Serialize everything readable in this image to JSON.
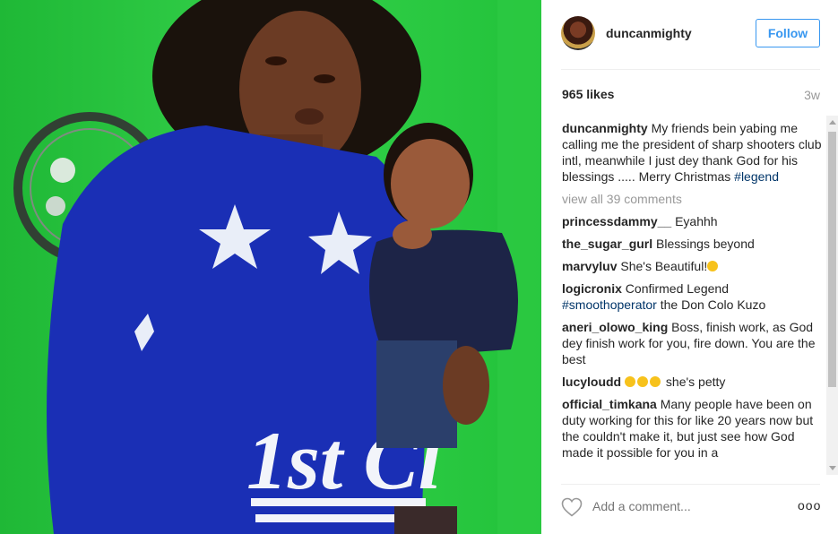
{
  "header": {
    "username": "duncanmighty",
    "follow_label": "Follow"
  },
  "stats": {
    "likes": "965 likes",
    "time_ago": "3w"
  },
  "caption": {
    "username": "duncanmighty",
    "text": "My friends bein yabing me calling me the president of sharp shooters club intl, meanwhile I just dey thank God for his blessings ..... Merry Christmas",
    "hashtag": "#legend"
  },
  "view_all": "view all 39 comments",
  "comments": [
    {
      "user": "princessdammy__",
      "text": "Eyahhh"
    },
    {
      "user": "the_sugar_gurl",
      "text": "Blessings beyond"
    },
    {
      "user": "marvyluv",
      "text": "She's Beautiful!"
    },
    {
      "user": "logicronix",
      "text": "Confirmed Legend",
      "hashtag": "#smoothoperator",
      "text2": "the Don Colo Kuzo"
    },
    {
      "user": "aneri_olowo_king",
      "text": "Boss, finish work, as God dey finish work for you, fire down. You are the best"
    },
    {
      "user": "lucyloudd",
      "text": "she's petty"
    },
    {
      "user": "official_timkana",
      "text": "Many people have been on duty working for this for like 20 years now but the couldn't make it, but just see how God made it possible for you in a"
    }
  ],
  "footer": {
    "add_comment_placeholder": "Add a comment...",
    "more_label": "ooo"
  },
  "photo": {
    "shirt_text": "1st Cl",
    "background_color": "#25c83c",
    "shirt_color": "#1a2fb5"
  },
  "icons": [
    "heart-icon",
    "more-options-icon",
    "avatar"
  ]
}
